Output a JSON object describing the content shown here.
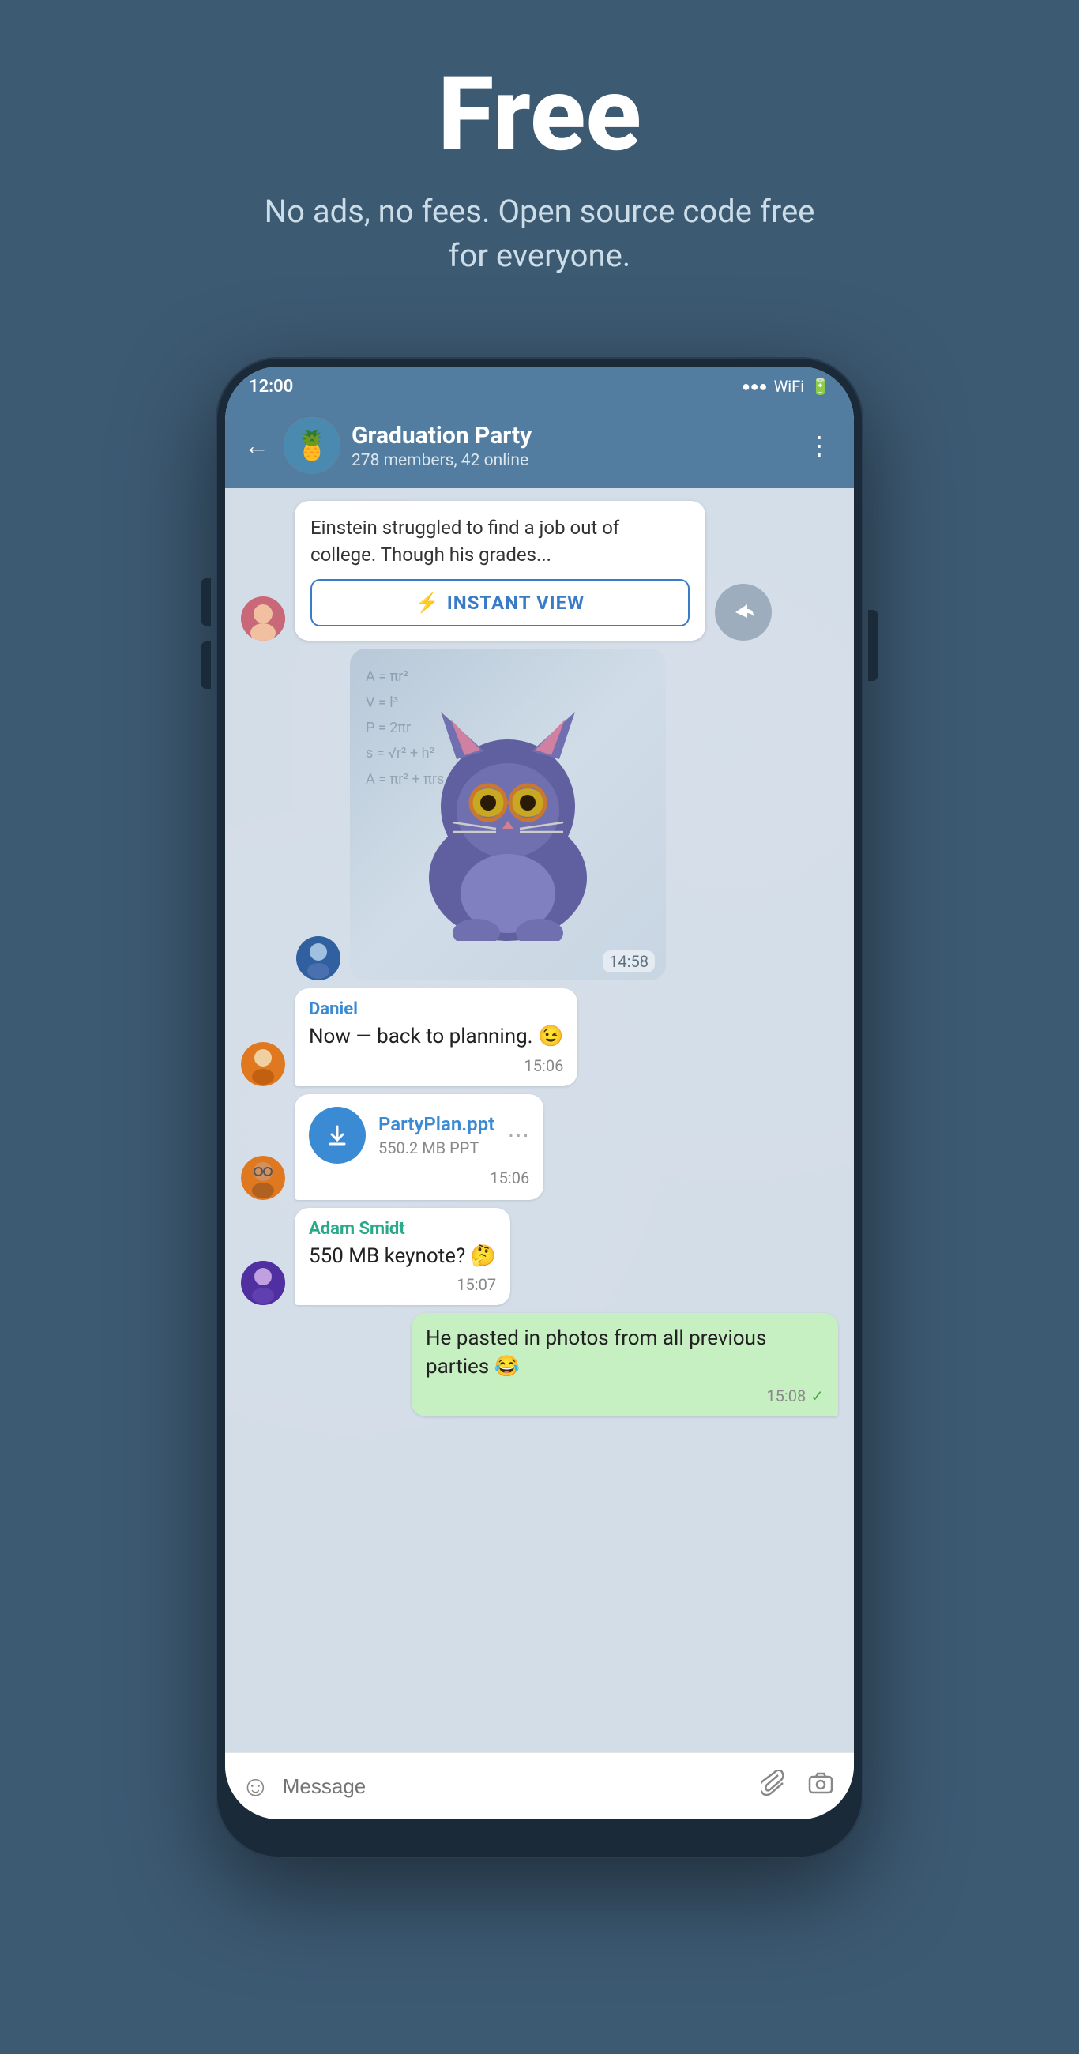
{
  "hero": {
    "title": "Free",
    "subtitle": "No ads, no fees. Open source code free for everyone."
  },
  "phone": {
    "status_bar": {
      "time": "12:00",
      "signal": "●●●",
      "wifi": "WiFi",
      "battery": "🔋"
    },
    "header": {
      "group_name": "Graduation Party",
      "members": "278 members, 42 online",
      "back_label": "←",
      "more_label": "⋮"
    },
    "messages": [
      {
        "id": "msg1",
        "type": "article",
        "sender": "girl",
        "article_text": "Einstein struggled to find a job out of college. Though his grades...",
        "instant_view_label": "INSTANT VIEW",
        "time": ""
      },
      {
        "id": "msg2",
        "type": "sticker",
        "sender": "boy",
        "time": "14:58"
      },
      {
        "id": "msg3",
        "type": "text",
        "sender": "Daniel",
        "sender_color": "blue",
        "text": "Now — back to planning. 😉",
        "time": "15:06"
      },
      {
        "id": "msg4",
        "type": "file",
        "sender": "man",
        "file_name": "PartyPlan.ppt",
        "file_size": "550.2 MB PPT",
        "time": "15:06"
      },
      {
        "id": "msg5",
        "type": "text",
        "sender": "Adam Smidt",
        "sender_color": "teal",
        "text": "550 MB keynote? 🤔",
        "time": "15:07"
      },
      {
        "id": "msg6",
        "type": "text_outgoing",
        "text": "He pasted in photos from all previous parties 😂",
        "time": "15:08",
        "read": true
      }
    ],
    "input_bar": {
      "placeholder": "Message"
    }
  }
}
